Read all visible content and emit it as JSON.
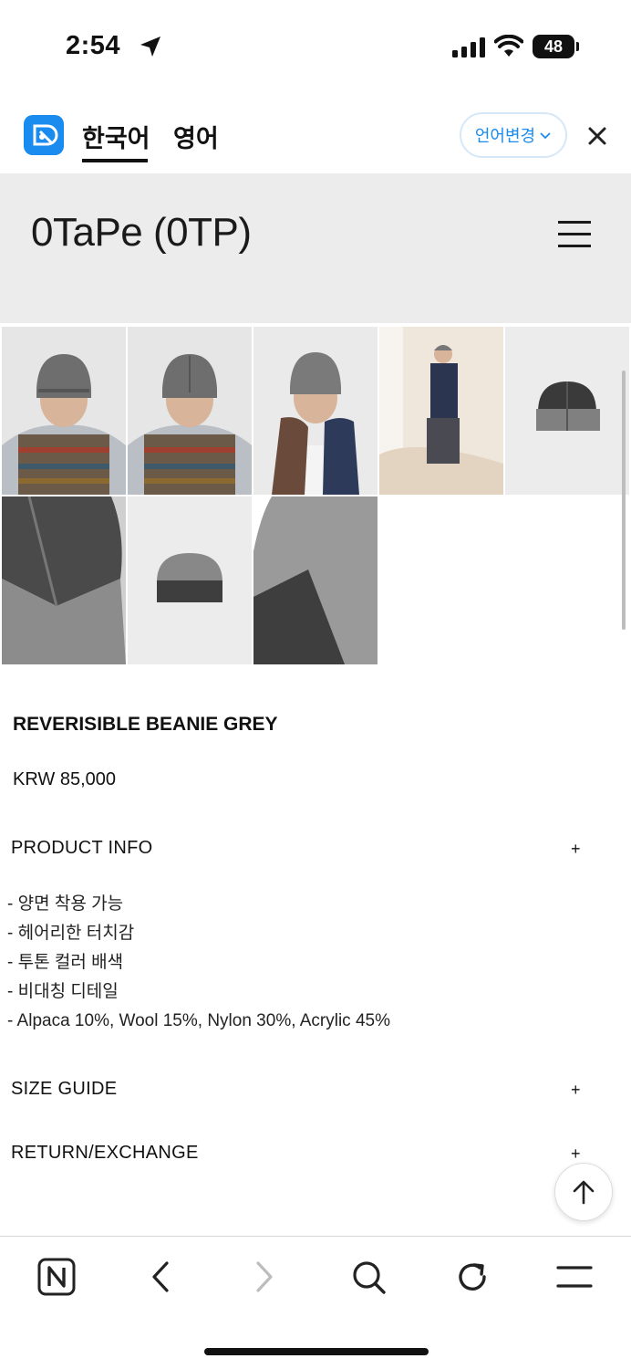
{
  "status_bar": {
    "time": "2:54",
    "battery": "48"
  },
  "translate_bar": {
    "tab_korean": "한국어",
    "tab_english": "영어",
    "change_language": "언어변경"
  },
  "site": {
    "title": "0TaPe (0TP)"
  },
  "gallery": {
    "image_count": 8
  },
  "product": {
    "name": "REVERISIBLE BEANIE GREY",
    "price": "KRW 85,000"
  },
  "sections": {
    "product_info": "PRODUCT INFO",
    "size_guide": "SIZE GUIDE",
    "return_exchange": "RETURN/EXCHANGE",
    "plus_symbol": "+"
  },
  "product_info_lines": [
    "- 양면 착용 가능",
    "- 헤어리한 터치감",
    "- 투톤 컬러 배색",
    "- 비대칭 디테일",
    "- Alpaca 10%, Wool 15%, Nylon 30%, Acrylic 45%"
  ],
  "colors": {
    "accent_blue": "#1a8cf0",
    "header_bg": "#ececec"
  }
}
